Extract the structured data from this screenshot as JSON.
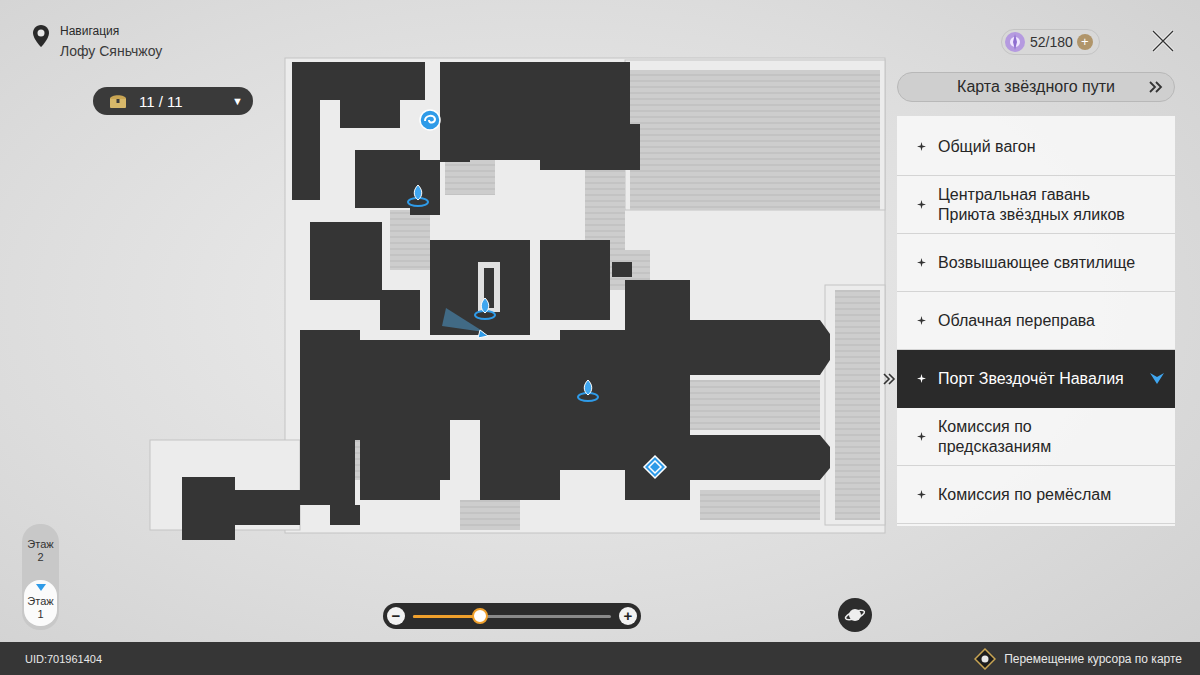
{
  "header": {
    "title": "Навигация",
    "location": "Лофу Сяньчжоу"
  },
  "currency": {
    "value": "52/180",
    "add": "+"
  },
  "chests": {
    "count": "11 / 11",
    "dropdown": "▼"
  },
  "star_map_button": {
    "label": "Карта звёздного пути"
  },
  "areas": [
    {
      "label": "Общий вагон",
      "selected": false
    },
    {
      "label": "Центральная гавань Приюта звёздных яликов",
      "selected": false
    },
    {
      "label": "Возвышающее святилище",
      "selected": false
    },
    {
      "label": "Облачная переправа",
      "selected": false
    },
    {
      "label": "Порт Звездочёт Навалия",
      "selected": true
    },
    {
      "label": "Комиссия по предсказаниям",
      "selected": false
    },
    {
      "label": "Комиссия по ремёслам",
      "selected": false
    }
  ],
  "floors": [
    {
      "label": "Этаж 2",
      "selected": false
    },
    {
      "label": "Этаж 1",
      "selected": true
    }
  ],
  "zoom": {
    "minus": "−",
    "plus": "+",
    "level": 0.34
  },
  "footer": {
    "uid": "UID:701961404",
    "hint": "Перемещение курсора по карте"
  }
}
